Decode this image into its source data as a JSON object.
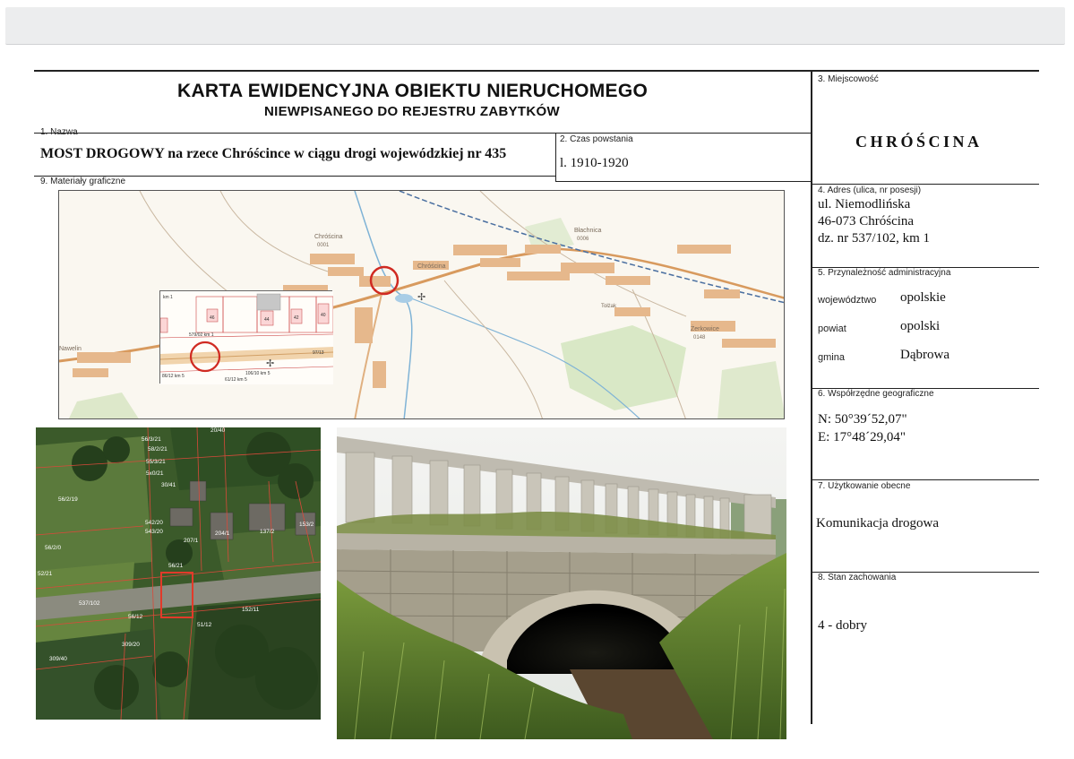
{
  "header": {
    "title": "KARTA EWIDENCYJNA OBIEKTU NIERUCHOMEGO",
    "subtitle": "NIEWPISANEGO DO REJESTRU ZABYTKÓW"
  },
  "fields": {
    "name": {
      "label": "1. Nazwa",
      "value": "MOST DROGOWY na rzece Chróścince w ciągu drogi wojewódzkiej nr 435"
    },
    "date": {
      "label": "2. Czas powstania",
      "value": "l. 1910-1920"
    },
    "place": {
      "label": "3. Miejscowość",
      "value": "CHRÓŚCINA"
    },
    "address": {
      "label": "4. Adres (ulica, nr posesji)",
      "lines": [
        "ul. Niemodlińska",
        "46-073 Chróścina",
        "dz. nr 537/102, km 1"
      ]
    },
    "admin": {
      "label": "5. Przynależność administracyjna",
      "rows": [
        {
          "key": "województwo",
          "value": "opolskie"
        },
        {
          "key": "powiat",
          "value": "opolski"
        },
        {
          "key": "gmina",
          "value": "Dąbrowa"
        }
      ]
    },
    "coords": {
      "label": "6. Współrzędne geograficzne",
      "n": "N: 50°39´52,07\"",
      "e": "E: 17°48´29,04\""
    },
    "usage": {
      "label": "7. Użytkowanie obecne",
      "value": "Komunikacja drogowa"
    },
    "condition": {
      "label": "8. Stan zachowania",
      "value": "4 - dobry"
    },
    "graphics": {
      "label": "9. Materiały graficzne"
    }
  },
  "map": {
    "places": [
      {
        "name": "Chróścina",
        "code": "0001"
      },
      {
        "name": "Chróścina"
      },
      {
        "name": "Błachnica",
        "code": "0006"
      },
      {
        "name": "Żerkowice",
        "code": "0148"
      },
      {
        "name": "Tołżak"
      },
      {
        "name": "Nawelin"
      }
    ],
    "inset_labels": [
      "km 1",
      "46",
      "44",
      "42",
      "40",
      "579/02 km 1",
      "86/12 km 5",
      "61/12 km 5",
      "97/13",
      "106/10 km 5"
    ]
  },
  "aerial": {
    "parcels": [
      "56/3/21",
      "58/2/21",
      "55/3/21",
      "5x0/21",
      "30/41",
      "56/2/19",
      "542/20",
      "543/20",
      "56/2/0",
      "52/21",
      "537/102",
      "56/12",
      "51/12",
      "152/11",
      "309/20",
      "309/40",
      "204/1",
      "137/2",
      "153/2",
      "207/1",
      "20/40",
      "56/21"
    ]
  },
  "colors": {
    "rule": "#222222",
    "settlement": "#e2b48a",
    "circle": "#d02a22",
    "parcel_line": "#d84a3a"
  }
}
